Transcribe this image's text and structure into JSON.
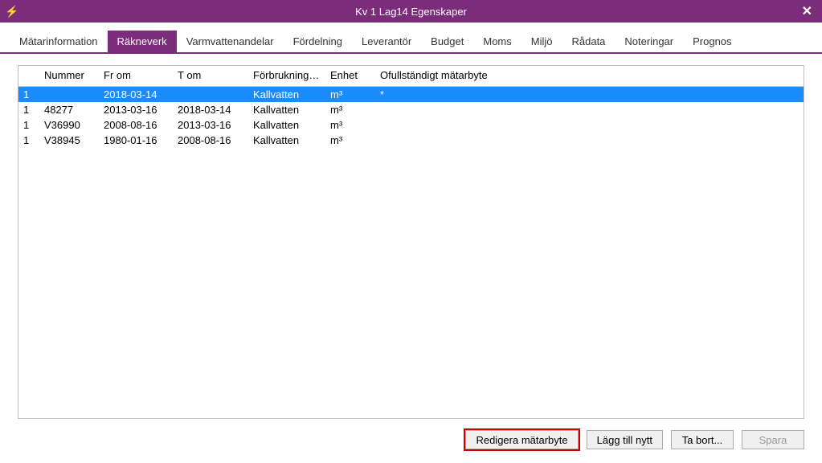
{
  "window": {
    "title": "Kv 1 Lag14 Egenskaper"
  },
  "tabs": {
    "items": [
      {
        "label": "Mätarinformation"
      },
      {
        "label": "Räkneverk"
      },
      {
        "label": "Varmvattenandelar"
      },
      {
        "label": "Fördelning"
      },
      {
        "label": "Leverantör"
      },
      {
        "label": "Budget"
      },
      {
        "label": "Moms"
      },
      {
        "label": "Miljö"
      },
      {
        "label": "Rådata"
      },
      {
        "label": "Noteringar"
      },
      {
        "label": "Prognos"
      }
    ],
    "active_index": 1
  },
  "grid": {
    "columns": {
      "idx": "",
      "nummer": "Nummer",
      "from": "Fr om",
      "to": "T om",
      "cons": "Förbruknings...",
      "unit": "Enhet",
      "incomplete": "Ofullständigt mätarbyte"
    },
    "rows": [
      {
        "idx": "1",
        "nummer": "",
        "from": "2018-03-14",
        "to": "",
        "cons": "Kallvatten",
        "unit": "m³",
        "incomplete": "*",
        "selected": true
      },
      {
        "idx": "1",
        "nummer": "48277",
        "from": "2013-03-16",
        "to": "2018-03-14",
        "cons": "Kallvatten",
        "unit": "m³",
        "incomplete": ""
      },
      {
        "idx": "1",
        "nummer": "V36990",
        "from": "2008-08-16",
        "to": "2013-03-16",
        "cons": "Kallvatten",
        "unit": "m³",
        "incomplete": ""
      },
      {
        "idx": "1",
        "nummer": "V38945",
        "from": "1980-01-16",
        "to": "2008-08-16",
        "cons": "Kallvatten",
        "unit": "m³",
        "incomplete": ""
      }
    ]
  },
  "buttons": {
    "edit": "Redigera mätarbyte",
    "add": "Lägg till nytt",
    "remove": "Ta bort...",
    "save": "Spara"
  }
}
